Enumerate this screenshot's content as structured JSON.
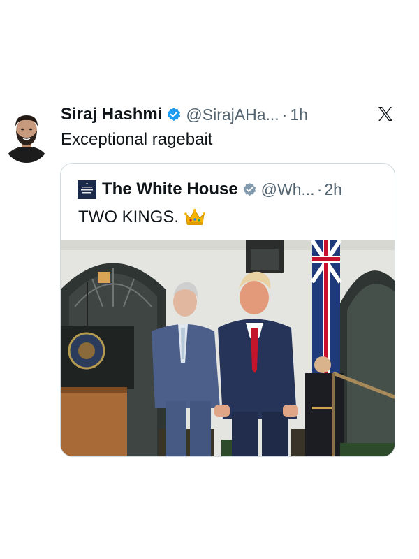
{
  "tweet": {
    "author_name": "Siraj Hashmi",
    "handle": "@SirajAHa...",
    "separator": "·",
    "time": "1h",
    "text": "Exceptional ragebait",
    "avatar_icon": "profile-avatar",
    "verified_icon": "verified-badge-icon",
    "platform_icon": "x-logo-icon"
  },
  "quoted_tweet": {
    "author_name": "The White House",
    "handle": "@Wh...",
    "separator": "·",
    "time": "2h",
    "text": "TWO KINGS.",
    "emoji_icon": "crown-emoji-icon",
    "avatar_icon": "white-house-logo-icon",
    "verified_icon": "gray-verified-badge-icon",
    "media_icon": "photo"
  },
  "colors": {
    "text_primary": "#0f1419",
    "text_secondary": "#536471",
    "verified_blue": "#1d9bf0",
    "gov_gray": "#829aab",
    "card_border": "#cfd9de"
  }
}
